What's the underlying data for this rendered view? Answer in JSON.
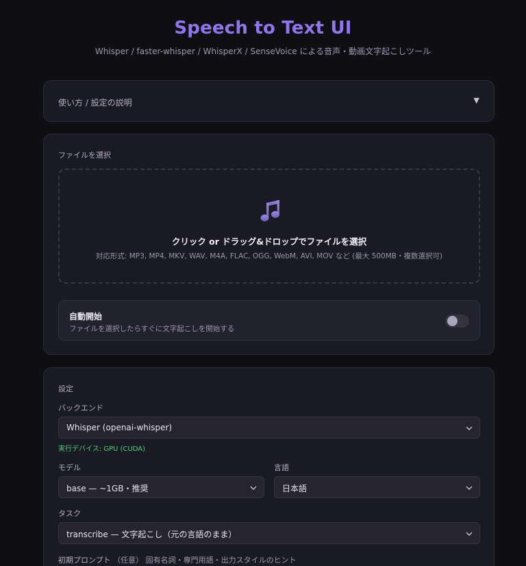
{
  "header": {
    "title": "Speech to Text UI",
    "subtitle": "Whisper / faster-whisper / WhisperX / SenseVoice による音声・動画文字起こしツール"
  },
  "help": {
    "title": "使い方 / 設定の説明",
    "arrow": "▼"
  },
  "file_section": {
    "label": "ファイルを選択",
    "dropzone_title": "クリック or ドラッグ&ドロップでファイルを選択",
    "dropzone_sub": "対応形式: MP3, MP4, MKV, WAV, M4A, FLAC, OGG, WebM, AVI, MOV など (最大 500MB・複数選択可)",
    "icon": "music-note-icon",
    "autostart_title": "自動開始",
    "autostart_desc": "ファイルを選択したらすぐに文字起こしを開始する",
    "autostart_enabled": false
  },
  "settings": {
    "label": "設定",
    "backend_label": "バックエンド",
    "backend_value": "Whisper (openai-whisper)",
    "device_info": "実行デバイス: GPU (CUDA)",
    "model_label": "モデル",
    "model_value": "base — ~1GB・推奨",
    "language_label": "言語",
    "language_value": "日本語",
    "task_label": "タスク",
    "task_value": "transcribe — 文字起こし（元の言語のまま）",
    "prompt_label": "初期プロンプト",
    "prompt_optional": "（任意）",
    "prompt_hint": "固有名詞・専門用語・出力スタイルのヒント"
  },
  "colors": {
    "accent": "#8f76ee",
    "background": "#0f0e13",
    "card": "#1a1a24",
    "device_ok": "#4fd07a"
  }
}
